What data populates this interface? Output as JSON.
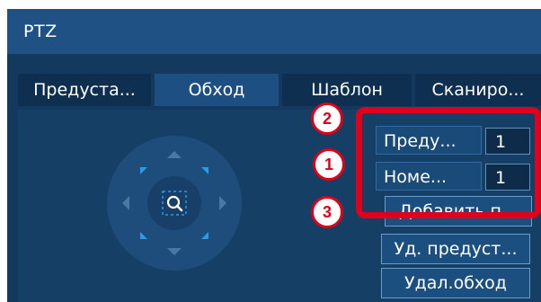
{
  "window": {
    "title": "PTZ"
  },
  "tabs": [
    {
      "label": "Предуста..."
    },
    {
      "label": "Обход"
    },
    {
      "label": "Шаблон"
    },
    {
      "label": "Сканиро..."
    }
  ],
  "tour_panel": {
    "preset_label": "Преду...",
    "preset_value": "1",
    "number_label": "Номе...",
    "number_value": "1",
    "add_preset_button": "Добавить п...",
    "delete_preset_button": "Уд. предуст...",
    "delete_tour_button": "Удал.обход"
  },
  "annotations": {
    "badge_1": "1",
    "badge_2": "2",
    "badge_3": "3",
    "highlight_color": "#e0001b"
  },
  "colors": {
    "background": "#13395e",
    "titlebar": "#1f5184",
    "accent_corners": "#2a9be6"
  }
}
